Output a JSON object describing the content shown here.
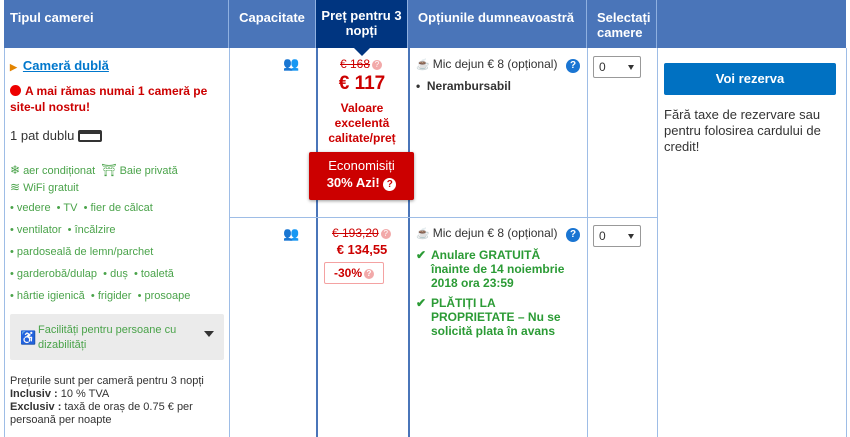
{
  "header": {
    "room_type": "Tipul camerei",
    "capacity": "Capacitate",
    "price": "Preț pentru 3 nopți",
    "options": "Opțiunile dumneavoastră",
    "select_line1": "Selectați",
    "select_line2": "camere"
  },
  "room": {
    "name": "Cameră dublă",
    "scarcity": "A mai rămas numai 1 cameră pe site-ul nostru!",
    "bed": "1 pat dublu",
    "facilities": {
      "ac": "aer condiționat",
      "bath": "Baie privată",
      "wifi": "WiFi gratuit",
      "row1": [
        "vedere",
        "TV",
        "fier de călcat"
      ],
      "row2": [
        "ventilator",
        "încălzire"
      ],
      "row3": [
        "pardoseală de lemn/parchet"
      ],
      "row4": [
        "garderobă/dulap",
        "duș",
        "toaletă"
      ],
      "row5": [
        "hârtie igienică",
        "frigider",
        "prosoape"
      ]
    },
    "accessibility": "Facilități pentru persoane cu dizabilități",
    "notes": {
      "line1": "Prețurile sunt per cameră pentru 3 nopți",
      "inclusive_label": "Inclusiv :",
      "inclusive_value": " 10 % TVA",
      "exclusive_label": "Exclusiv :",
      "exclusive_value": " taxă de oraș de 0.75 € per persoană per noapte"
    }
  },
  "offer1": {
    "old_price": "€ 168",
    "price": "€ 117",
    "value_text": "Valoare excelentă calitate/preț",
    "save_line1": "Economisiți",
    "save_line2": "30% Azi!",
    "breakfast": "Mic dejun € 8 (opțional)",
    "policy": "Nerambursabil",
    "selected": "0"
  },
  "offer2": {
    "old_price": "€ 193,20",
    "price": "€ 134,55",
    "discount": "-30%",
    "breakfast": "Mic dejun € 8 (opțional)",
    "free_cancel": "Anulare GRATUITĂ înainte de 14 noiembrie 2018 ora 23:59",
    "pay_at_property": "PLĂTIȚI LA PROPRIETATE – Nu se solicită plata în avans",
    "selected": "0"
  },
  "reserve_button": "Voi rezerva",
  "no_fee_text": "Fără taxe de rezervare sau pentru folosirea cardului de credit!",
  "colors": {
    "header_bg": "#4a75b9",
    "price_header_bg": "#003580",
    "price_red": "#cc0000",
    "green": "#2b9b35",
    "button_blue": "#0071c2"
  }
}
